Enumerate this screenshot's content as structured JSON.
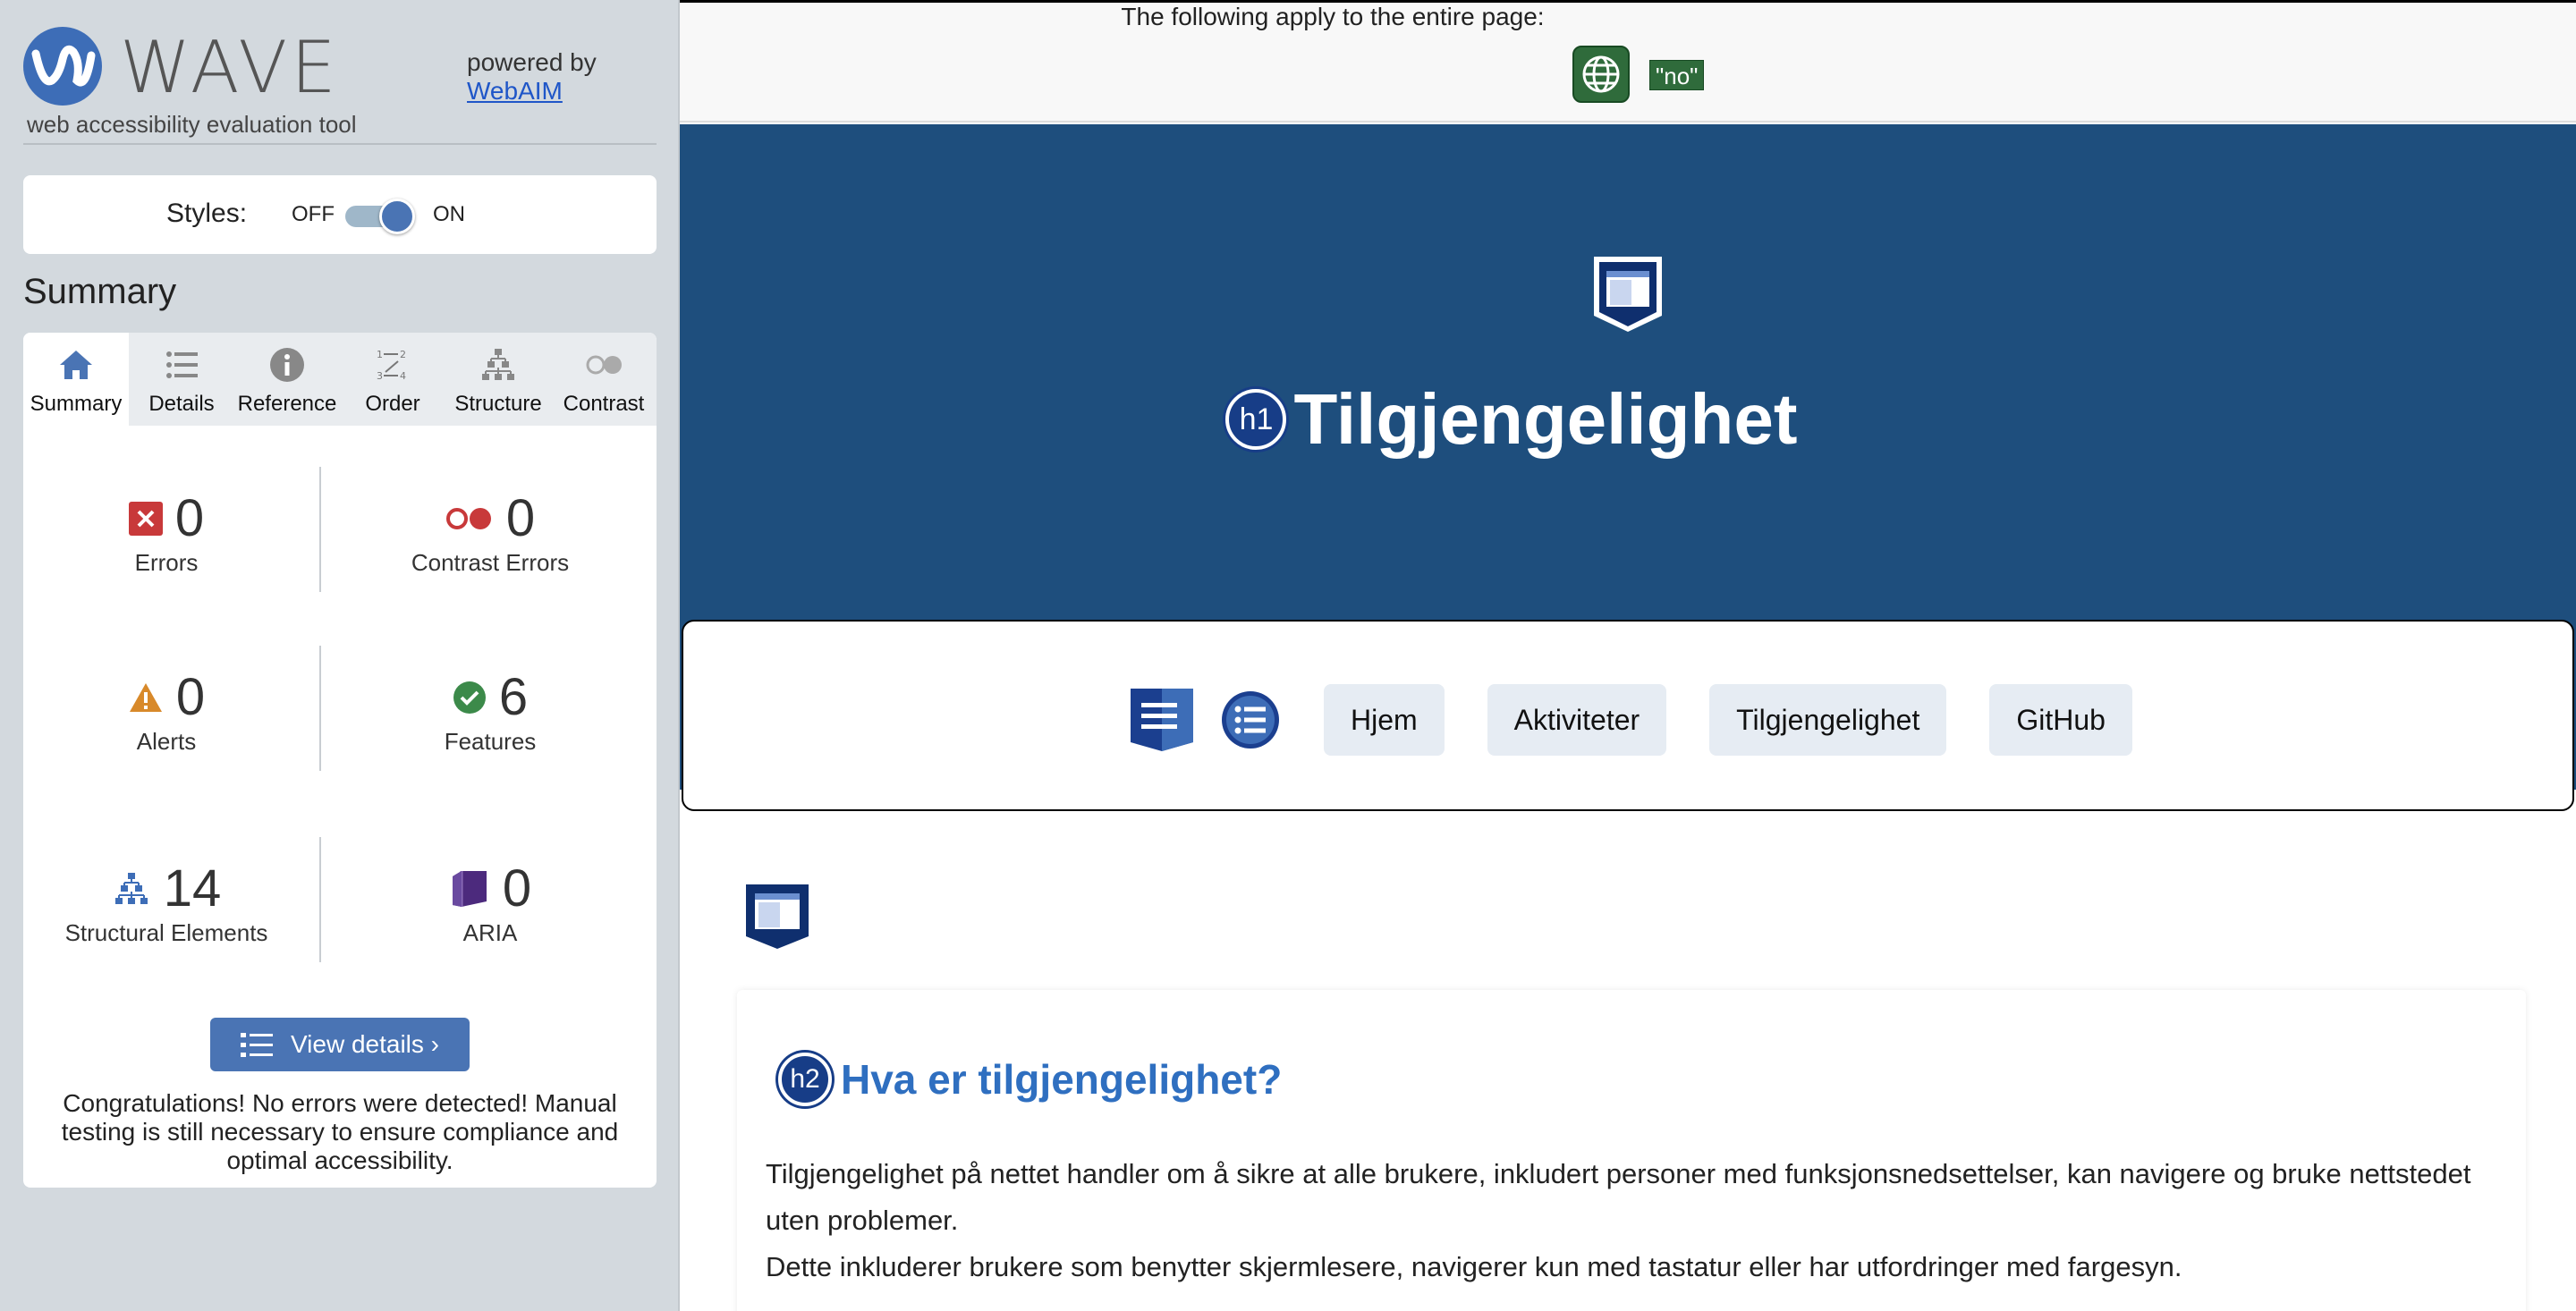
{
  "wave": {
    "name": "WAVE",
    "tagline": "web accessibility evaluation tool",
    "powered_by": "powered by",
    "webaim": "WebAIM",
    "styles_label": "Styles:",
    "styles_off": "OFF",
    "styles_on": "ON",
    "styles_enabled": true,
    "summary_title": "Summary",
    "tabs": [
      {
        "label": "Summary",
        "icon": "home-icon",
        "active": true
      },
      {
        "label": "Details",
        "icon": "list-icon",
        "active": false
      },
      {
        "label": "Reference",
        "icon": "info-icon",
        "active": false
      },
      {
        "label": "Order",
        "icon": "order-icon",
        "active": false
      },
      {
        "label": "Structure",
        "icon": "structure-icon",
        "active": false
      },
      {
        "label": "Contrast",
        "icon": "contrast-icon",
        "active": false
      }
    ],
    "stats": {
      "errors": {
        "count": "0",
        "label": "Errors"
      },
      "contrast_errors": {
        "count": "0",
        "label": "Contrast Errors"
      },
      "alerts": {
        "count": "0",
        "label": "Alerts"
      },
      "features": {
        "count": "6",
        "label": "Features"
      },
      "structural": {
        "count": "14",
        "label": "Structural Elements"
      },
      "aria": {
        "count": "0",
        "label": "ARIA"
      }
    },
    "view_details": "View details ›",
    "congrats": "Congratulations! No errors were detected! Manual testing is still necessary to ensure compliance and optimal accessibility."
  },
  "page": {
    "apply_text": "The following apply to the entire page:",
    "lang_badge": "\"no\"",
    "h1_badge": "h1",
    "title": "Tilgjengelighet",
    "nav": [
      "Hjem",
      "Aktiviteter",
      "Tilgjengelighet",
      "GitHub"
    ],
    "h2_badge": "h2",
    "h2": "Hva er tilgjengelighet?",
    "para1": "Tilgjengelighet på nettet handler om å sikre at alle brukere, inkludert personer med funksjonsnedsettelser, kan navigere og bruke nettstedet uten problemer.",
    "para2": "Dette inkluderer brukere som benytter skjermlesere, navigerer kun med tastatur eller har utfordringer med fargesyn."
  },
  "colors": {
    "wave_blue": "#4a74b4",
    "hero_bg": "#1e4e7d",
    "heading_blue": "#2f6fc0",
    "lang_green": "#2f6b3b"
  }
}
